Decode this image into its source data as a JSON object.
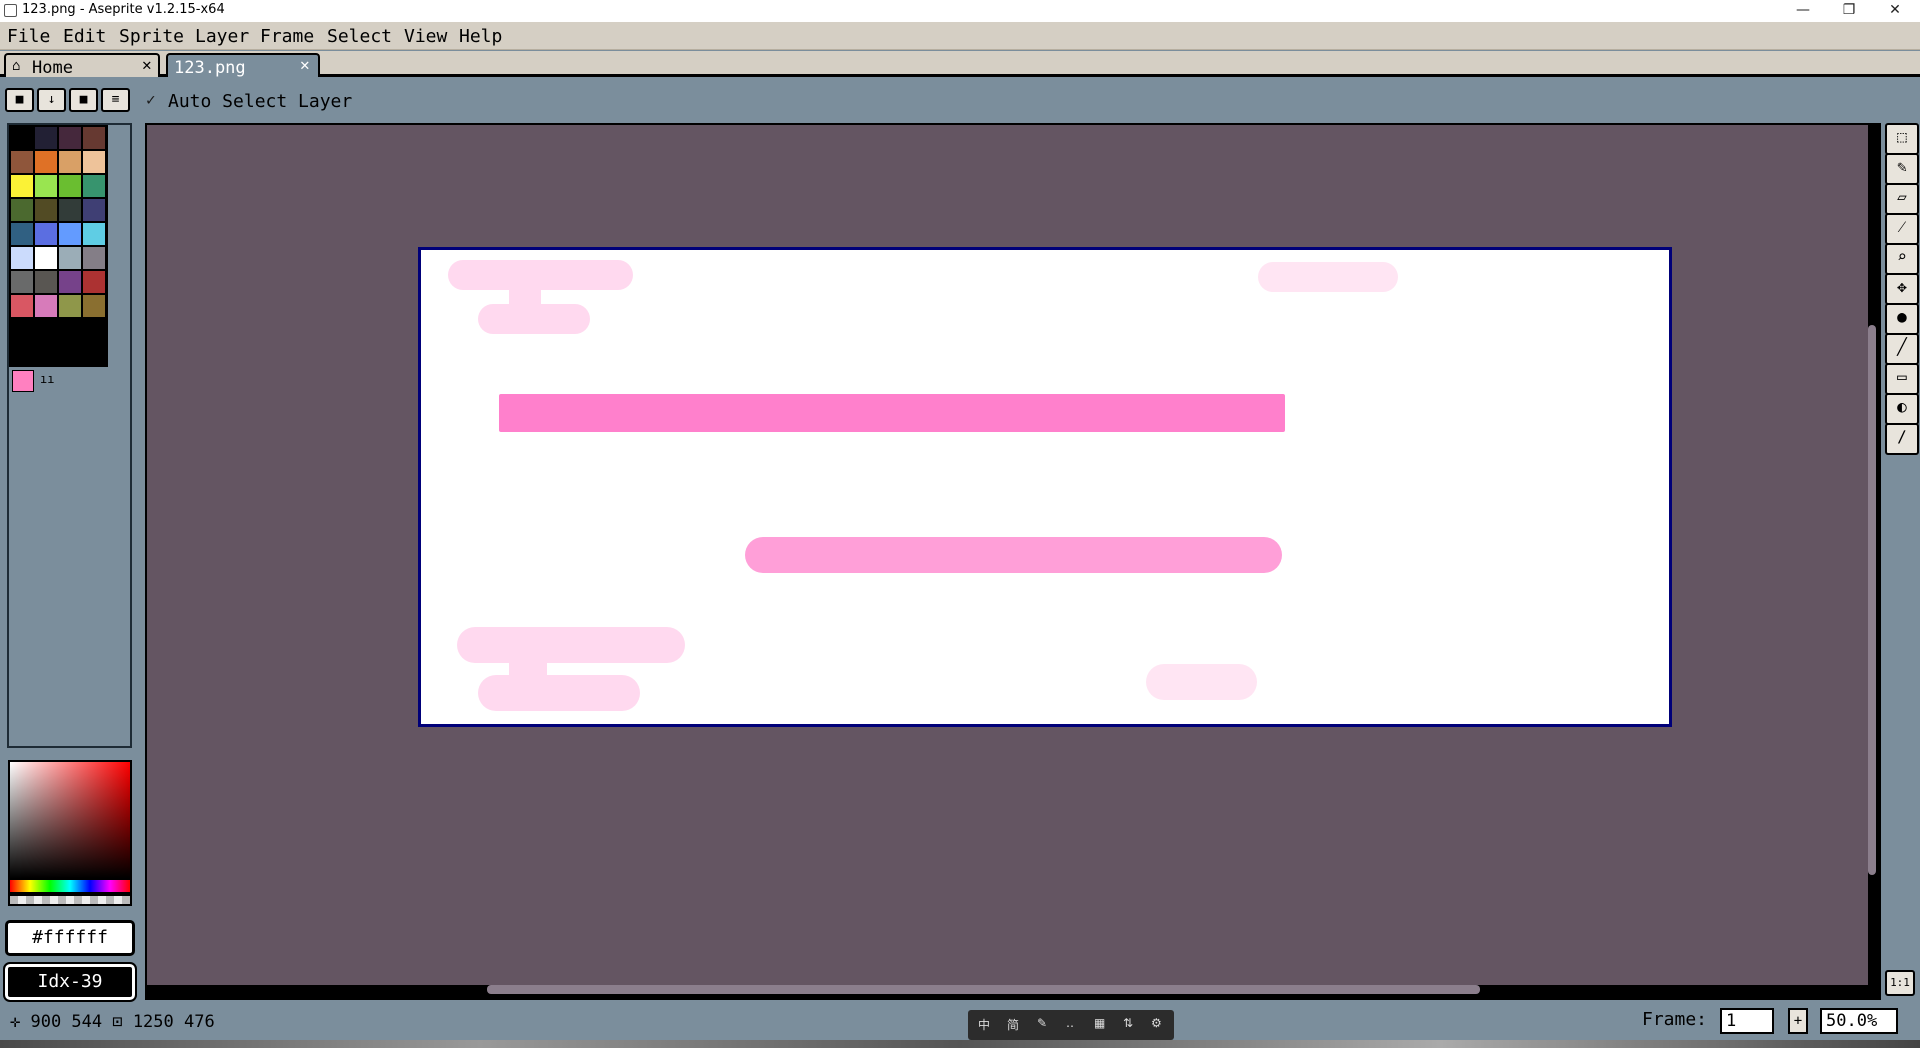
{
  "window": {
    "title": "123.png - Aseprite v1.2.15-x64",
    "minimize": "—",
    "restore": "❐",
    "close": "✕"
  },
  "menu": [
    "File",
    "Edit",
    "Sprite",
    "Layer",
    "Frame",
    "Select",
    "View",
    "Help"
  ],
  "tabs": [
    {
      "label": "Home",
      "active": false
    },
    {
      "label": "123.png",
      "active": true
    }
  ],
  "toolbar": {
    "auto_select_layer": "Auto Select Layer"
  },
  "palette": {
    "colors": [
      "#000000",
      "#222034",
      "#45283c",
      "#663931",
      "#8f563b",
      "#df7126",
      "#d9a066",
      "#eec39a",
      "#fbf236",
      "#99e550",
      "#6abe30",
      "#37946e",
      "#4b692f",
      "#524b24",
      "#323c39",
      "#3f3f74",
      "#306082",
      "#5b6ee1",
      "#639bff",
      "#5fcde4",
      "#cbdbfc",
      "#ffffff",
      "#9badb7",
      "#847e87",
      "#696a6a",
      "#595652",
      "#76428a",
      "#ac3232",
      "#d95763",
      "#d77bba",
      "#8f974a",
      "#8a6f30"
    ],
    "foreground": "#ff80c0",
    "hex_value": "#ffffff",
    "index_label": "Idx-39"
  },
  "status": {
    "text": "✛ 900  544 ⊡ 1250  476",
    "frame_label": "Frame:",
    "frame_value": "1",
    "frame_plus": "+",
    "zoom": "50.0%"
  },
  "tools": [
    "marquee-tool-icon",
    "pencil-tool-icon",
    "eraser-tool-icon",
    "eyedropper-tool-icon",
    "zoom-tool-icon",
    "move-tool-icon",
    "paint-bucket-tool-icon",
    "line-tool-icon",
    "rectangle-tool-icon",
    "contour-tool-icon",
    "blur-tool-icon"
  ],
  "one_to_one": "1:1",
  "sprite_colors": {
    "border": "#000079",
    "bar_main": "#ff80cc",
    "bar_secondary": "#ff9fd8",
    "blob_light": "#ffd9ef",
    "blob_faint": "#ffe5f3"
  }
}
